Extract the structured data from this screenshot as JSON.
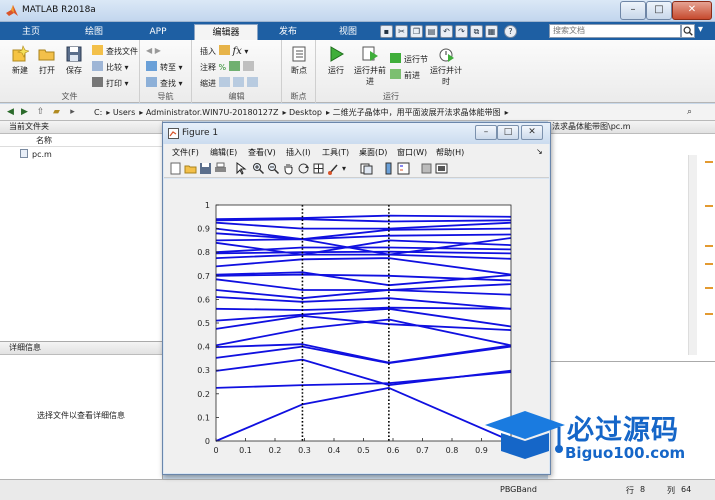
{
  "window": {
    "title": "MATLAB R2018a"
  },
  "ribbon_tabs": [
    "主页",
    "绘图",
    "APP",
    "编辑器",
    "发布",
    "视图"
  ],
  "active_tab": "编辑器",
  "search": {
    "placeholder": "搜索文档"
  },
  "ribbon": {
    "file_group": {
      "label": "文件",
      "new": "新建",
      "open": "打开",
      "save": "保存",
      "find_files": "查找文件",
      "compare": "比较",
      "print": "打印"
    },
    "nav_group": {
      "label": "导航",
      "goto": "转至",
      "find": "查找"
    },
    "edit_group": {
      "label": "编辑",
      "insert": "插入",
      "comment": "注释",
      "indent": "缩进"
    },
    "breakpoint_group": {
      "label": "断点",
      "breakpoints": "断点"
    },
    "run_group": {
      "label": "运行",
      "run": "运行",
      "run_advance": "运行并前进",
      "run_section": "运行节",
      "advance": "前进",
      "run_time": "运行并计时"
    }
  },
  "address": {
    "path": [
      "C:",
      "Users",
      "Administrator.WIN7U-20180127Z",
      "Desktop",
      "二维光子晶体中，用平面波展开法求晶体能带图"
    ]
  },
  "current_folder": {
    "title": "当前文件夹",
    "col_name": "名称",
    "file": "pc.m"
  },
  "details": {
    "title": "详细信息",
    "message": "选择文件以查看详细信息"
  },
  "editor": {
    "tab": "法求晶体能带图\\pc.m"
  },
  "status": {
    "function": "PBGBand",
    "row_label": "行",
    "row": "8",
    "col_label": "列",
    "col": "64"
  },
  "figure": {
    "title": "Figure 1",
    "menus": [
      "文件(F)",
      "编辑(E)",
      "查看(V)",
      "插入(I)",
      "工具(T)",
      "桌面(D)",
      "窗口(W)",
      "帮助(H)"
    ]
  },
  "watermark": {
    "title": "必过源码",
    "url": "Biguo100.com"
  },
  "colors": {
    "band": "#1010e0",
    "ribbon_blue": "#1e5fa3",
    "watermark": "#1566c8"
  },
  "chart_data": {
    "type": "line",
    "xlabel": "",
    "ylabel": "",
    "title": "",
    "xlim": [
      0,
      1
    ],
    "ylim": [
      0,
      1
    ],
    "xticks": [
      "0",
      "0.1",
      "0.2",
      "0.3",
      "0.4",
      "0.5",
      "0.6",
      "0.7",
      "0.8",
      "0.9",
      "1"
    ],
    "yticks": [
      "0",
      "0.1",
      "0.2",
      "0.3",
      "0.4",
      "0.5",
      "0.6",
      "0.7",
      "0.8",
      "0.9",
      "1"
    ],
    "x": [
      0,
      0.293,
      0.586,
      1.0
    ],
    "vlines": [
      0.293,
      0.586
    ],
    "series": [
      {
        "values": [
          0.0,
          0.155,
          0.225,
          0.0
        ]
      },
      {
        "values": [
          0.225,
          0.237,
          0.245,
          0.292
        ]
      },
      {
        "values": [
          0.297,
          0.345,
          0.237,
          0.298
        ]
      },
      {
        "values": [
          0.352,
          0.4,
          0.33,
          0.4
        ]
      },
      {
        "values": [
          0.398,
          0.41,
          0.332,
          0.405
        ]
      },
      {
        "values": [
          0.405,
          0.475,
          0.515,
          0.405
        ]
      },
      {
        "values": [
          0.475,
          0.53,
          0.495,
          0.47
        ]
      },
      {
        "values": [
          0.51,
          0.535,
          0.56,
          0.485
        ]
      },
      {
        "values": [
          0.56,
          0.555,
          0.565,
          0.56
        ]
      },
      {
        "values": [
          0.61,
          0.59,
          0.605,
          0.56
        ]
      },
      {
        "values": [
          0.64,
          0.605,
          0.64,
          0.62
        ]
      },
      {
        "values": [
          0.685,
          0.64,
          0.64,
          0.665
        ]
      },
      {
        "values": [
          0.7,
          0.705,
          0.7,
          0.68
        ]
      },
      {
        "values": [
          0.705,
          0.715,
          0.66,
          0.703
        ]
      },
      {
        "values": [
          0.74,
          0.77,
          0.775,
          0.705
        ]
      },
      {
        "values": [
          0.775,
          0.79,
          0.79,
          0.772
        ]
      },
      {
        "values": [
          0.795,
          0.8,
          0.802,
          0.795
        ]
      },
      {
        "values": [
          0.8,
          0.82,
          0.82,
          0.812
        ]
      },
      {
        "values": [
          0.84,
          0.79,
          0.85,
          0.83
        ]
      },
      {
        "values": [
          0.85,
          0.855,
          0.79,
          0.86
        ]
      },
      {
        "values": [
          0.88,
          0.855,
          0.87,
          0.875
        ]
      },
      {
        "values": [
          0.9,
          0.855,
          0.895,
          0.9
        ]
      },
      {
        "values": [
          0.925,
          0.9,
          0.9,
          0.925
        ]
      },
      {
        "values": [
          0.935,
          0.94,
          0.93,
          0.935
        ]
      },
      {
        "values": [
          0.94,
          0.945,
          0.955,
          0.95
        ]
      }
    ]
  }
}
